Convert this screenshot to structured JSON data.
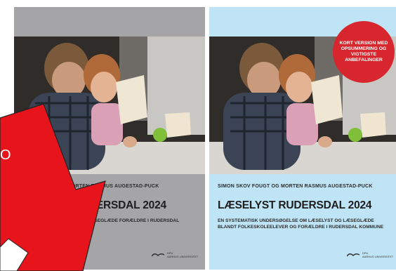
{
  "covers": [
    {
      "authors": "SKOV FOUGT OG MORTEN RASMUS AUGESTAD-PUCK",
      "title": "ESELYST RUDERSDAL 2024",
      "subtitle": "UNDERSØ  M LÆSELYST OG LÆSEGLÆDE  FORÆLDRE I RUDERSDAL KOMMUNE",
      "logo_line1": "DPU",
      "logo_line2": "AARHUS UNIVERSITET",
      "background": "#a5a4a6"
    },
    {
      "authors": "SIMON SKOV FOUGT OG MORTEN RASMUS AUGESTAD-PUCK",
      "title": "LÆSELYST RUDERSDAL 2024",
      "subtitle": "EN SYSTEMATISK UNDERSØGELSE OM LÆSELYST OG LÆSEGLÆDE BLANDT FOLKESKOLEELEVER OG FORÆLDRE I RUDERSDAL KOMMUNE",
      "logo_line1": "DPU",
      "logo_line2": "AARHUS UNIVERSITET",
      "background": "#bfe4f5"
    }
  ],
  "badge": {
    "text": "KORT VERSION MED OPSUMMERING OG VIGTIGSTE ANBEFALINGER",
    "color": "#d7262d"
  },
  "overlay": {
    "text": "O",
    "arrow_color": "#e8141c"
  }
}
